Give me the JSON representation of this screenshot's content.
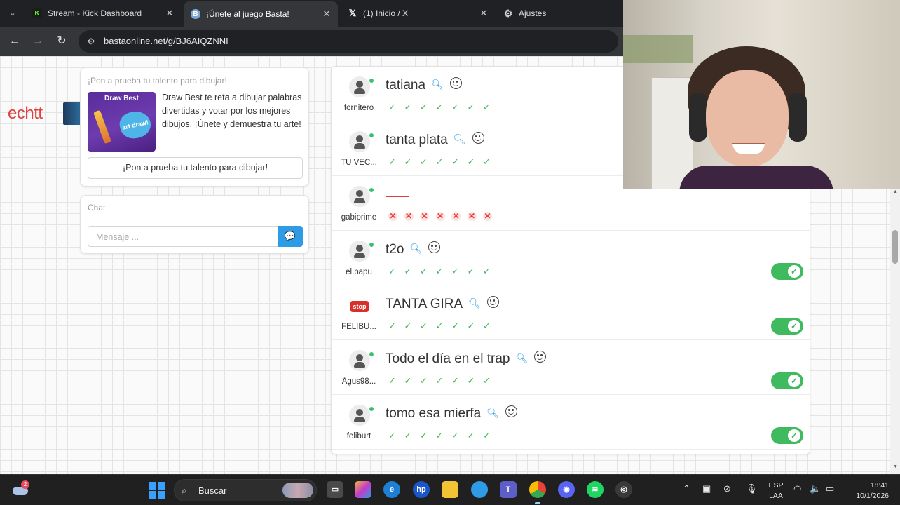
{
  "browser": {
    "tabs": [
      {
        "title": "Stream - Kick Dashboard",
        "favicon": "kick-icon",
        "active": false
      },
      {
        "title": "¡Únete al juego Basta!",
        "favicon": "basta-icon",
        "active": true
      },
      {
        "title": "(1) Inicio / X",
        "favicon": "x-icon",
        "active": false
      },
      {
        "title": "Ajustes",
        "favicon": "gear-icon",
        "active": false
      }
    ],
    "url": "bastaonline.net/g/BJ6AIQZNNI"
  },
  "page": {
    "deco_text": "echtt",
    "promo": {
      "heading": "¡Pon a prueba tu talento para dibujar!",
      "image_title": "Draw Best",
      "image_burst": "art draw!",
      "description": "Draw Best te reta a dibujar palabras divertidas y votar por los mejores dibujos. ¡Únete y demuestra tu arte!",
      "button_label": "¡Pon a prueba tu talento para dibujar!"
    },
    "chat": {
      "label": "Chat",
      "placeholder": "Mensaje ..."
    },
    "players": [
      {
        "answer": "tatiana",
        "owner": "fornitero",
        "avatar": "user-icon",
        "marks": [
          "ok",
          "ok",
          "ok",
          "ok",
          "ok",
          "ok",
          "ok"
        ],
        "toggle": false
      },
      {
        "answer": "tanta plata",
        "owner": "TU VEC...",
        "avatar": "user-icon",
        "marks": [
          "ok",
          "ok",
          "ok",
          "ok",
          "ok",
          "ok",
          "ok"
        ],
        "toggle": false
      },
      {
        "answer": "",
        "owner": "gabiprime",
        "avatar": "user-icon",
        "marks": [
          "bad",
          "bad",
          "bad",
          "bad",
          "bad",
          "bad",
          "bad"
        ],
        "toggle": false
      },
      {
        "answer": "t2o",
        "owner": "el.papu",
        "avatar": "user-star-icon",
        "marks": [
          "ok",
          "ok",
          "ok",
          "ok",
          "ok",
          "ok",
          "ok"
        ],
        "toggle": true
      },
      {
        "answer": "TANTA GIRA",
        "owner": "FELIBU...",
        "avatar": "stop-sign-icon",
        "marks": [
          "ok",
          "ok",
          "ok",
          "ok",
          "ok",
          "ok",
          "ok"
        ],
        "toggle": true
      },
      {
        "answer": "Todo el día en el trap",
        "owner": "Agus98...",
        "avatar": "user-icon",
        "marks": [
          "ok",
          "ok",
          "ok",
          "ok",
          "ok",
          "ok",
          "ok"
        ],
        "toggle": true
      },
      {
        "answer": "tomo esa mierfa",
        "owner": "feliburt",
        "avatar": "user-icon",
        "marks": [
          "ok",
          "ok",
          "ok",
          "ok",
          "ok",
          "ok",
          "ok"
        ],
        "toggle": true
      }
    ],
    "stop_sign_text": "stop"
  },
  "taskbar": {
    "search_label": "Buscar",
    "widget_badge": "2",
    "lang_line1": "ESP",
    "lang_line2": "LAA",
    "time": "18:41",
    "date": "10/1/2026"
  },
  "colors": {
    "accent_blue": "#2d9be5",
    "ok_green": "#3fba5e",
    "error_red": "#e0403c"
  }
}
